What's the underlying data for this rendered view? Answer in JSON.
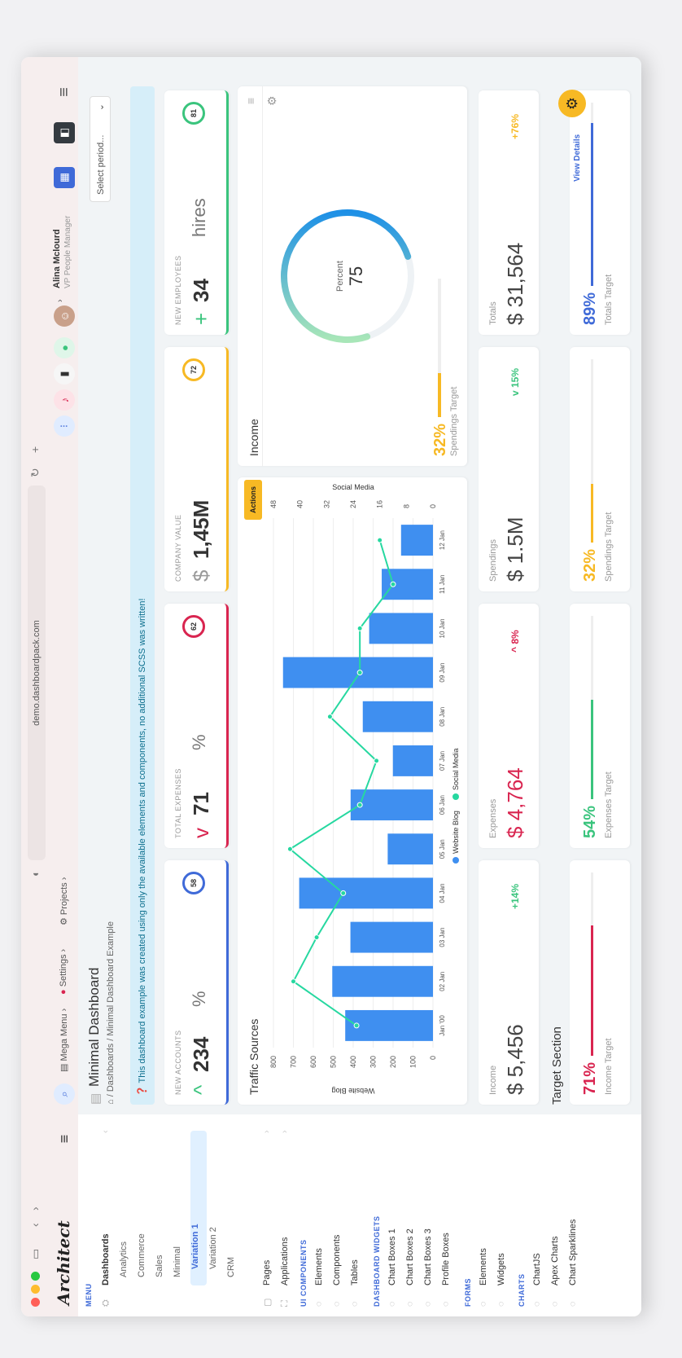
{
  "browser": {
    "url": "demo.dashboardpack.com"
  },
  "header": {
    "logo": "Architect",
    "mega_menu": "Mega Menu",
    "settings": "Settings",
    "projects": "Projects",
    "user_name": "Alina Mclourd",
    "user_role": "VP People Manager"
  },
  "sidebar": {
    "menu_heading": "MENU",
    "dashboards": "Dashboards",
    "dash_items": [
      "Analytics",
      "Commerce",
      "Sales",
      "Minimal",
      "Variation 1",
      "Variation 2",
      "CRM"
    ],
    "pages": "Pages",
    "applications": "Applications",
    "ui_heading": "UI COMPONENTS",
    "ui_items": [
      "Elements",
      "Components",
      "Tables"
    ],
    "widgets_heading": "DASHBOARD WIDGETS",
    "widget_items": [
      "Chart Boxes 1",
      "Chart Boxes 2",
      "Chart Boxes 3",
      "Profile Boxes"
    ],
    "forms_heading": "FORMS",
    "form_items": [
      "Elements",
      "Widgets"
    ],
    "charts_heading": "CHARTS",
    "chart_items": [
      "ChartJS",
      "Apex Charts",
      "Chart Sparklines"
    ]
  },
  "page": {
    "title": "Minimal Dashboard",
    "breadcrumb_1": "Dashboards",
    "breadcrumb_2": "Minimal Dashboard Example",
    "select_period": "Select period...",
    "alert": "This dashboard example was created using only the available elements and components, no additional SCSS was written!"
  },
  "stats": [
    {
      "label": "NEW ACCOUNTS",
      "sign": "^",
      "value": "234",
      "unit": "%",
      "ring": "58",
      "color": "#3f6ad8"
    },
    {
      "label": "TOTAL EXPENSES",
      "sign": "v",
      "value": "71",
      "unit": "%",
      "ring": "62",
      "color": "#d92550"
    },
    {
      "label": "COMPANY VALUE",
      "sign": "$",
      "value": "1,45M",
      "unit": "",
      "ring": "72",
      "color": "#f7b924"
    },
    {
      "label": "NEW EMPLOYEES",
      "sign": "+",
      "value": "34",
      "unit": "hires",
      "ring": "81",
      "color": "#3ac47d"
    }
  ],
  "traffic": {
    "title": "Traffic Sources",
    "actions": "Actions",
    "left_axis": "Website Blog",
    "right_axis": "Social Media"
  },
  "chart_data": {
    "type": "bar",
    "categories": [
      "Jan '00",
      "02 Jan",
      "03 Jan",
      "04 Jan",
      "05 Jan",
      "06 Jan",
      "07 Jan",
      "08 Jan",
      "09 Jan",
      "10 Jan",
      "11 Jan",
      "12 Jan"
    ],
    "series": [
      {
        "name": "Website Blog",
        "type": "bar",
        "values": [
          440,
          505,
          414,
          671,
          227,
          413,
          201,
          352,
          752,
          320,
          257,
          160
        ]
      },
      {
        "name": "Social Media",
        "type": "line",
        "values": [
          23,
          42,
          35,
          27,
          43,
          22,
          17,
          31,
          22,
          22,
          12,
          16
        ]
      }
    ],
    "ylim_left": [
      0,
      800
    ],
    "ylim_right": [
      0,
      48
    ],
    "yticks_left": [
      "0",
      "100",
      "200",
      "300",
      "400",
      "500",
      "600",
      "700",
      "800"
    ],
    "yticks_right": [
      "0",
      "8",
      "16",
      "24",
      "32",
      "40",
      "48"
    ]
  },
  "income": {
    "title": "Income",
    "gauge_label": "Percent",
    "gauge_value": "75",
    "gauge_fraction": 0.75,
    "spend_pct": "32%",
    "spend_label": "Spendings Target"
  },
  "summary": [
    {
      "label": "Income",
      "value": "$ 5,456",
      "delta": "+14%",
      "delta_color": "#3ac47d"
    },
    {
      "label": "Expenses",
      "value": "$ 4,764",
      "delta": "^ 8%",
      "delta_color": "#d92550"
    },
    {
      "label": "Spendings",
      "value": "$ 1.5M",
      "delta": "v 15%",
      "delta_color": "#3ac47d"
    },
    {
      "label": "Totals",
      "value": "$ 31,564",
      "delta": "+76%",
      "delta_color": "#f7b924"
    }
  ],
  "targets": {
    "title": "Target Section",
    "view_details": "View Details",
    "items": [
      {
        "pct": "71%",
        "label": "Income Target",
        "fraction": 0.71,
        "color": "#d92550"
      },
      {
        "pct": "54%",
        "label": "Expenses Target",
        "fraction": 0.54,
        "color": "#3ac47d"
      },
      {
        "pct": "32%",
        "label": "Spendings Target",
        "fraction": 0.32,
        "color": "#f7b924"
      },
      {
        "pct": "89%",
        "label": "Totals Target",
        "fraction": 0.89,
        "color": "#3f6ad8"
      }
    ]
  }
}
